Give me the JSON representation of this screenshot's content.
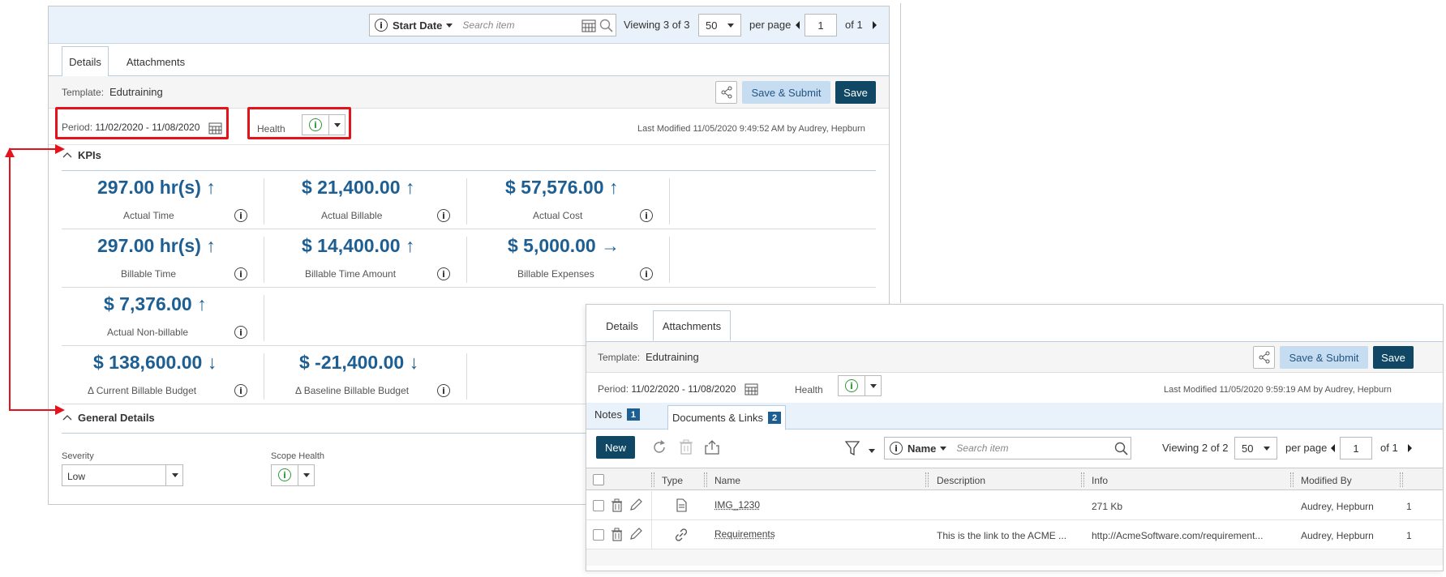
{
  "panel1": {
    "search": {
      "field": "Start Date",
      "placeholder": "Search item"
    },
    "paging": {
      "viewing_prefix": "Viewing",
      "viewing_current": "3",
      "viewing_of": "of",
      "viewing_total": "3",
      "page_size": "50",
      "per_page": "per page",
      "page": "1",
      "of_pages": "of",
      "total_pages": "1"
    },
    "tabs": [
      {
        "label": "Details"
      },
      {
        "label": "Attachments"
      }
    ],
    "template_label": "Template:",
    "template_value": "Edutraining",
    "buttons": {
      "save_submit": "Save & Submit",
      "save": "Save"
    },
    "period_label": "Period:",
    "period_value": "11/02/2020 - 11/08/2020",
    "health_label": "Health",
    "last_modified": "Last Modified 11/05/2020 9:49:52 AM by Audrey, Hepburn",
    "kpis_title": "KPIs",
    "kpis": [
      {
        "value": "297.00 hr(s)",
        "trend": "↑",
        "label": "Actual Time"
      },
      {
        "value": "$ 21,400.00",
        "trend": "↑",
        "label": "Actual Billable"
      },
      {
        "value": "$ 57,576.00",
        "trend": "↑",
        "label": "Actual Cost"
      },
      {
        "value": "297.00 hr(s)",
        "trend": "↑",
        "label": "Billable Time"
      },
      {
        "value": "$ 14,400.00",
        "trend": "↑",
        "label": "Billable Time Amount"
      },
      {
        "value": "$ 5,000.00",
        "trend": "→",
        "label": "Billable Expenses"
      },
      {
        "value": "$ 7,376.00",
        "trend": "↑",
        "label": "Actual Non-billable"
      },
      {
        "value": "$ 138,600.00",
        "trend": "↓",
        "label": "Δ Current Billable Budget"
      },
      {
        "value": "$ -21,400.00",
        "trend": "↓",
        "label": "Δ Baseline Billable Budget"
      }
    ],
    "general_title": "General Details",
    "severity_label": "Severity",
    "severity_value": "Low",
    "scope_health_label": "Scope Health"
  },
  "panel2": {
    "tabs": [
      {
        "label": "Details"
      },
      {
        "label": "Attachments"
      }
    ],
    "template_label": "Template:",
    "template_value": "Edutraining",
    "buttons": {
      "save_submit": "Save & Submit",
      "save": "Save",
      "new": "New"
    },
    "period_label": "Period:",
    "period_value": "11/02/2020 - 11/08/2020",
    "health_label": "Health",
    "last_modified": "Last Modified 11/05/2020 9:59:19 AM by Audrey, Hepburn",
    "subtabs": [
      {
        "label": "Notes",
        "count": "1"
      },
      {
        "label": "Documents & Links",
        "count": "2"
      }
    ],
    "search": {
      "field": "Name",
      "placeholder": "Search item"
    },
    "paging": {
      "viewing_prefix": "Viewing",
      "viewing_current": "2",
      "viewing_of": "of",
      "viewing_total": "2",
      "page_size": "50",
      "per_page": "per page",
      "page": "1",
      "of_pages": "of",
      "total_pages": "1"
    },
    "columns": [
      "Type",
      "Name",
      "Description",
      "Info",
      "Modified By"
    ],
    "rows": [
      {
        "name": "IMG_1230",
        "description": "",
        "info": "271 Kb",
        "modified_by": "Audrey, Hepburn",
        "extra": "1"
      },
      {
        "name": "Requirements",
        "description": "This is the link to the ACME ...",
        "info": "http://AcmeSoftware.com/requirement...",
        "modified_by": "Audrey, Hepburn",
        "extra": "1"
      }
    ]
  },
  "colors": {
    "accent": "#1d5e93",
    "save_dark": "#0f4764",
    "save_light": "#c5dcf1",
    "highlight_red": "#e4121a",
    "health_green": "#2e9b3a"
  }
}
